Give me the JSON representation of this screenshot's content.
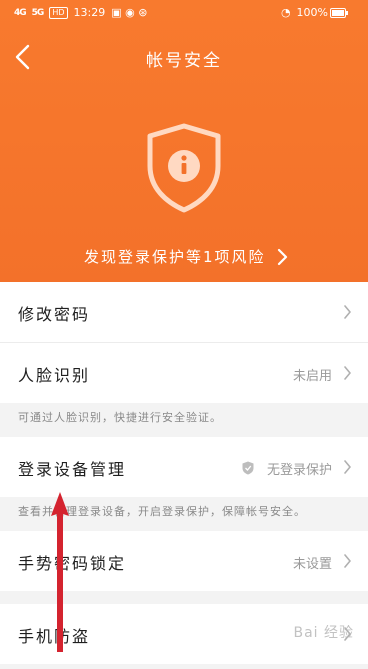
{
  "status_bar": {
    "signal_1": "4G",
    "signal_2": "5G",
    "hd": "HD",
    "time": "13:29",
    "battery": "100%"
  },
  "header": {
    "title": "帐号安全",
    "risk_text": "发现登录保护等1项风险",
    "icon": "shield-info-icon"
  },
  "rows": [
    {
      "label": "修改密码",
      "status": ""
    },
    {
      "label": "人脸识别",
      "status": "未启用",
      "note": "可通过人脸识别，快捷进行安全验证。"
    },
    {
      "label": "登录设备管理",
      "status": "无登录保护",
      "note": "查看并管理登录设备，开启登录保护，保障帐号安全。"
    },
    {
      "label": "手势密码锁定",
      "status": "未设置"
    },
    {
      "label": "手机防盗",
      "status": ""
    }
  ],
  "watermark": "Bai 经验",
  "colors": {
    "accent": "#f3712a",
    "arrow": "#d4232f"
  }
}
